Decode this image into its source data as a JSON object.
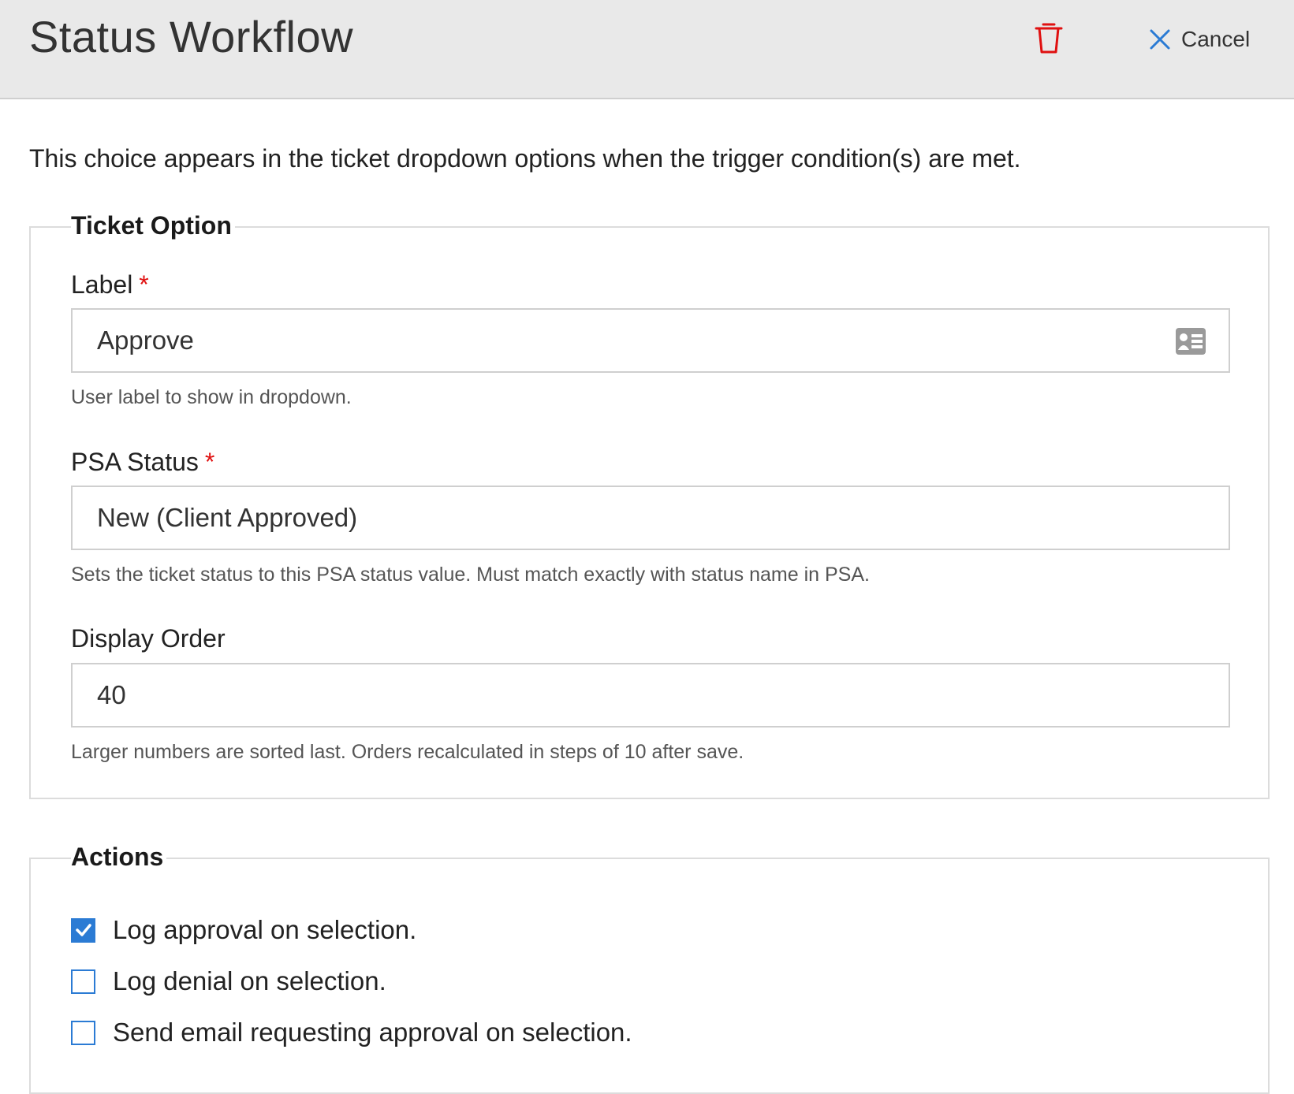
{
  "header": {
    "title": "Status Workflow",
    "delete_icon": "trash-icon",
    "cancel_label": "Cancel",
    "cancel_icon": "close-icon"
  },
  "intro": "This choice appears in the ticket dropdown options when the trigger condition(s) are met.",
  "ticket_option": {
    "legend": "Ticket Option",
    "label_field": {
      "label": "Label",
      "required_mark": "*",
      "value": "Approve",
      "icon": "contact-card-icon",
      "help": "User label to show in dropdown."
    },
    "psa_status_field": {
      "label": "PSA Status",
      "required_mark": "*",
      "value": "New (Client Approved)",
      "help": "Sets the ticket status to this PSA status value. Must match exactly with status name in PSA."
    },
    "display_order_field": {
      "label": "Display Order",
      "value": "40",
      "help": "Larger numbers are sorted last. Orders recalculated in steps of 10 after save."
    }
  },
  "actions": {
    "legend": "Actions",
    "items": [
      {
        "label": "Log approval on selection.",
        "checked": true
      },
      {
        "label": "Log denial on selection.",
        "checked": false
      },
      {
        "label": "Send email requesting approval on selection.",
        "checked": false
      }
    ]
  },
  "colors": {
    "accent": "#2b7bd4",
    "danger": "#e01010",
    "header_bg": "#e9e9e9"
  }
}
